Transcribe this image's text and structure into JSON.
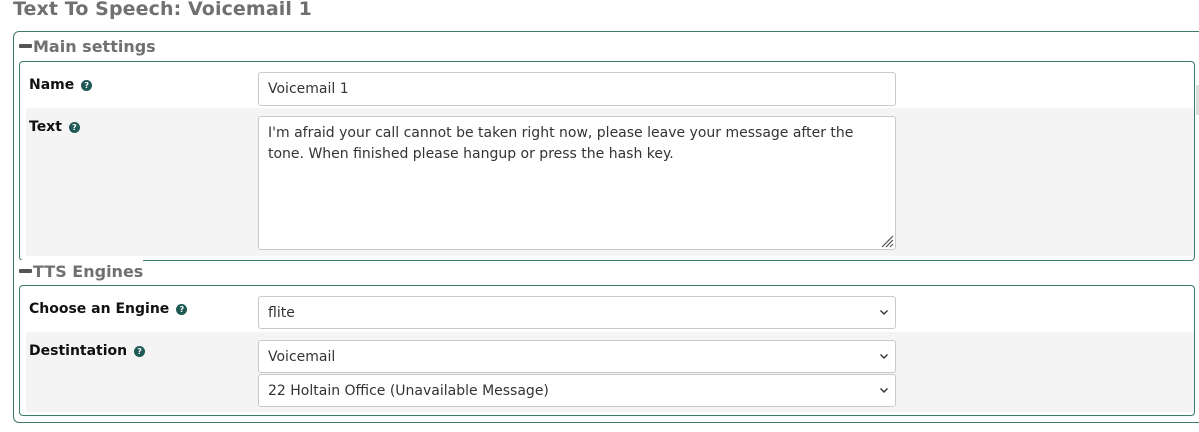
{
  "page": {
    "title": "Text To Speech: Voicemail 1"
  },
  "main_settings": {
    "legend": "Main settings",
    "name": {
      "label": "Name",
      "value": "Voicemail 1"
    },
    "text": {
      "label": "Text",
      "value": "I'm afraid your call cannot be taken right now, please leave your message after the tone. When finished please hangup or press the hash key."
    }
  },
  "tts_engines": {
    "legend": "TTS Engines",
    "engine": {
      "label": "Choose an Engine",
      "selected": "flite"
    },
    "destination": {
      "label": "Destintation",
      "type_selected": "Voicemail",
      "target_selected": "22 Holtain Office (Unavailable Message)"
    }
  },
  "icons": {
    "help": "help-icon",
    "collapse": "minus-icon",
    "dropdown": "chevron-down-icon",
    "resize": "resize-handle-icon"
  },
  "colors": {
    "accent_border": "#3c7a6f",
    "help_icon": "#1f5a56",
    "title_text": "#707070",
    "alt_row": "#f4f4f4"
  }
}
